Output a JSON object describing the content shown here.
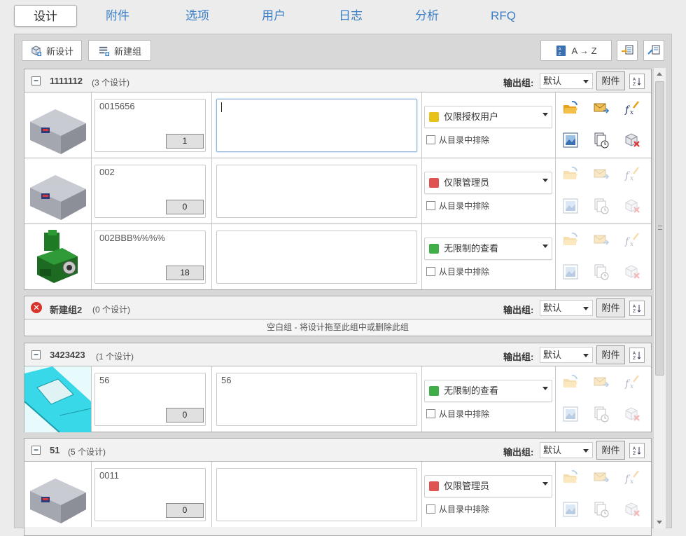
{
  "tabs": [
    {
      "label": "设计",
      "active": true
    },
    {
      "label": "附件",
      "active": false
    },
    {
      "label": "选项",
      "active": false
    },
    {
      "label": "用户",
      "active": false
    },
    {
      "label": "日志",
      "active": false
    },
    {
      "label": "分析",
      "active": false
    },
    {
      "label": "RFQ",
      "active": false
    }
  ],
  "toolbar": {
    "new_design": "新设计",
    "new_group": "新建组",
    "sort_label": "A → Z"
  },
  "common": {
    "output_group_label": "输出组:",
    "output_group_value": "默认",
    "attach_label": "附件",
    "exclude_label": "从目录中排除",
    "empty_group_text": "空白组 - 将设计拖至此组中或删除此组"
  },
  "groups": [
    {
      "name": "1111112",
      "count_label": "(3 个设计)",
      "rows": [
        {
          "name": "0015656",
          "count": "1",
          "description": "",
          "permission": "仅限授权用户",
          "perm_color": "#e8c21a",
          "actions_enabled": true,
          "thumb": "box"
        },
        {
          "name": "002",
          "count": "0",
          "description": "",
          "permission": "仅限管理员",
          "perm_color": "#e05353",
          "actions_enabled": false,
          "thumb": "box"
        },
        {
          "name": "002BBB%%%%",
          "count": "18",
          "description": "",
          "permission": "无限制的查看",
          "perm_color": "#3fae49",
          "actions_enabled": false,
          "thumb": "machine"
        }
      ]
    },
    {
      "name": "新建组2",
      "count_label": "(0 个设计)",
      "rows": []
    },
    {
      "name": "3423423",
      "count_label": "(1 个设计)",
      "rows": [
        {
          "name": "56",
          "count": "0",
          "description": "56",
          "permission": "无限制的查看",
          "perm_color": "#3fae49",
          "actions_enabled": false,
          "thumb": "cyan"
        }
      ]
    },
    {
      "name": "51",
      "count_label": "(5 个设计)",
      "rows": [
        {
          "name": "0011",
          "count": "0",
          "description": "",
          "permission": "仅限管理员",
          "perm_color": "#e05353",
          "actions_enabled": false,
          "thumb": "box"
        }
      ]
    }
  ],
  "colors": {
    "tab_link": "#3a7fc6",
    "delete_red": "#d9342b"
  }
}
